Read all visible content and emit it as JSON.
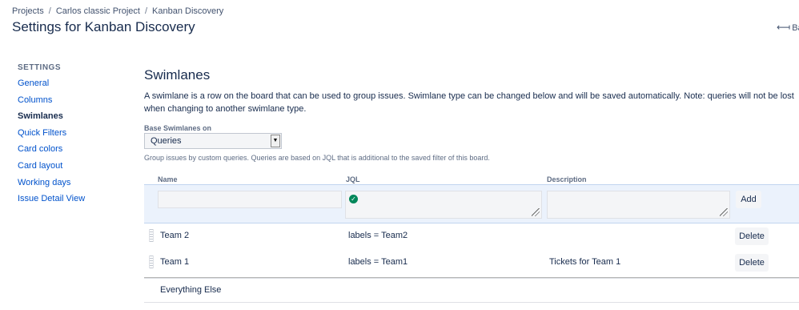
{
  "breadcrumb": {
    "items": [
      "Projects",
      "Carlos classic Project",
      "Kanban Discovery"
    ],
    "separator": "/"
  },
  "header": {
    "title": "Settings for Kanban Discovery",
    "back_label": "Bac",
    "back_icon": "arrow-left-icon"
  },
  "sidebar": {
    "heading": "SETTINGS",
    "items": [
      {
        "label": "General",
        "active": false
      },
      {
        "label": "Columns",
        "active": false
      },
      {
        "label": "Swimlanes",
        "active": true
      },
      {
        "label": "Quick Filters",
        "active": false
      },
      {
        "label": "Card colors",
        "active": false
      },
      {
        "label": "Card layout",
        "active": false
      },
      {
        "label": "Working days",
        "active": false
      },
      {
        "label": "Issue Detail View",
        "active": false
      }
    ]
  },
  "main": {
    "title": "Swimlanes",
    "description": "A swimlane is a row on the board that can be used to group issues. Swimlane type can be changed below and will be saved automatically. Note: queries will not be lost when changing to another swimlane type.",
    "base_label": "Base Swimlanes on",
    "base_value": "Queries",
    "help_text": "Group issues by custom queries. Queries are based on JQL that is additional to the saved filter of this board.",
    "columns": {
      "name": "Name",
      "jql": "JQL",
      "description": "Description"
    },
    "add_label": "Add",
    "delete_label": "Delete",
    "rows": [
      {
        "name": "Team 2",
        "jql": "labels = Team2",
        "description": ""
      },
      {
        "name": "Team 1",
        "jql": "labels = Team1",
        "description": "Tickets for Team 1"
      }
    ],
    "default_row": "Everything Else"
  },
  "colors": {
    "link": "#0052cc",
    "text": "#172b4d",
    "muted": "#5e6c84",
    "add_row_bg": "#ebf2fc",
    "valid": "#00875a"
  }
}
